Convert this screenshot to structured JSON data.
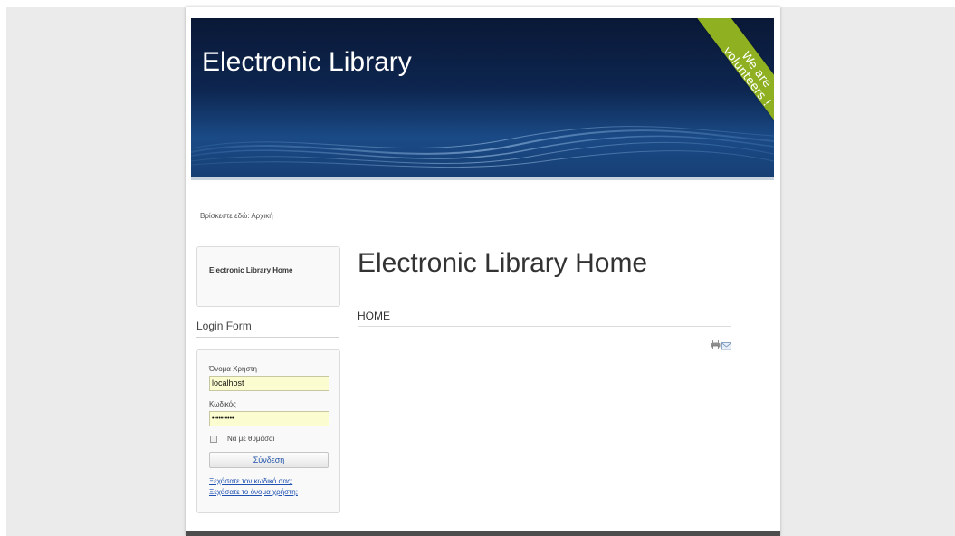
{
  "header": {
    "title": "Electronic Library",
    "ribbon_line1": "We are",
    "ribbon_line2": "volunteers !"
  },
  "breadcrumb": {
    "text": "Βρίσκεστε εδώ: Αρχική"
  },
  "menu": {
    "items": [
      {
        "label": "Electronic Library Home"
      }
    ]
  },
  "login": {
    "title": "Login Form",
    "username_label": "Όνομα Χρήστη",
    "username_value": "localhost",
    "password_label": "Κωδικός",
    "password_value": "••••••••••",
    "remember_label": "Να με θυμάσαι",
    "submit_label": "Σύνδεση",
    "forgot_password": "Ξεχάσατε τον κωδικό σας;",
    "forgot_username": "Ξεχάσατε το όνομα χρήστη;"
  },
  "main": {
    "title": "Electronic Library Home",
    "tab_label": "HOME"
  },
  "icons": {
    "print": "print-icon",
    "email": "email-icon"
  },
  "colors": {
    "banner_dark": "#0a1836",
    "banner_blue": "#1a4a86",
    "ribbon_green": "#8fb021",
    "field_yellow": "#fbfccf",
    "link_blue": "#1e50b0"
  }
}
